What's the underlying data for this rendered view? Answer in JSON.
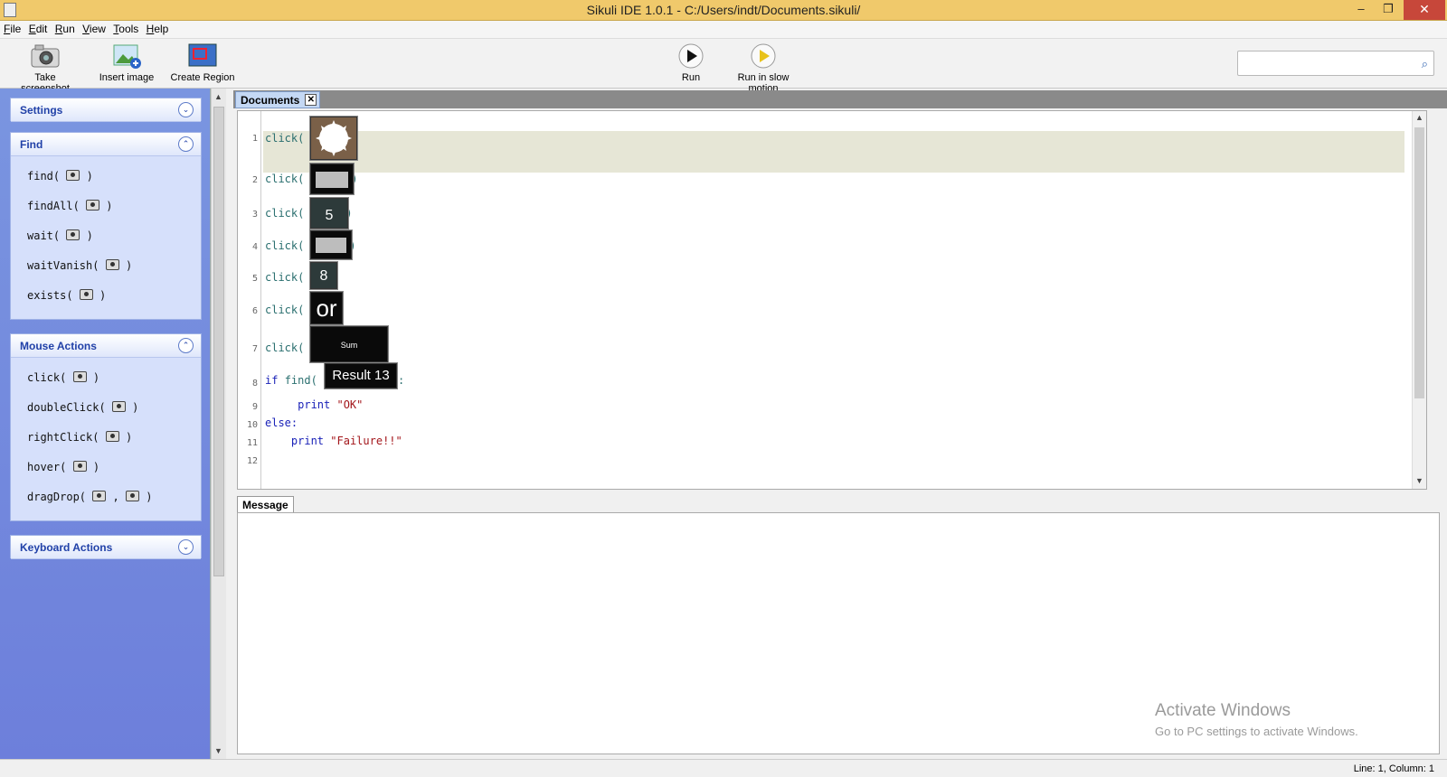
{
  "window": {
    "title": "Sikuli IDE 1.0.1 - C:/Users/indt/Documents.sikuli/",
    "minimize": "–",
    "restore": "❐",
    "close": "✕"
  },
  "menu": [
    "File",
    "Edit",
    "Run",
    "View",
    "Tools",
    "Help"
  ],
  "toolbar": {
    "take_screenshot": "Take screenshot",
    "insert_image": "Insert image",
    "create_region": "Create Region",
    "run": "Run",
    "run_slow": "Run in slow motion",
    "search_placeholder": "",
    "search_icon": "⌕"
  },
  "sidebar": {
    "settings": {
      "title": "Settings",
      "chevron": "⌄"
    },
    "find": {
      "title": "Find",
      "chevron": "⌃",
      "commands": [
        "find(",
        "findAll(",
        "wait(",
        "waitVanish(",
        "exists("
      ]
    },
    "mouse": {
      "title": "Mouse Actions",
      "chevron": "⌃",
      "commands": [
        "click(",
        "doubleClick(",
        "rightClick(",
        "hover(",
        "dragDrop("
      ]
    },
    "keyboard": {
      "title": "Keyboard Actions",
      "chevron": "⌄"
    },
    "close_paren": ")",
    "comma": ","
  },
  "editor": {
    "tab": "Documents",
    "tab_close": "✕",
    "line_numbers": [
      "1",
      "2",
      "3",
      "4",
      "5",
      "6",
      "7",
      "8",
      "9",
      "10",
      "11",
      "12"
    ],
    "lines": {
      "l1": "click(",
      "l2": "click(",
      "l3": "click(",
      "l4": "click(",
      "l5": "click(",
      "l6": "click(",
      "l7": "click(",
      "l8_kw": "if",
      "l8_fn": "find(",
      "l8_end": "):",
      "l9_kw": "print",
      "l9_str": "\"OK\"",
      "l10_kw": "else:",
      "l11_kw": "print",
      "l11_str": "\"Failure!!\"",
      "close": ")"
    },
    "shots": {
      "s3": "5",
      "s5": "8",
      "s6": "or",
      "s7": "Sum",
      "s8": "Result  13"
    }
  },
  "message": {
    "tab": "Message"
  },
  "watermark": {
    "line1": "Activate Windows",
    "line2": "Go to PC settings to activate Windows."
  },
  "status": "Line: 1, Column: 1",
  "colors": {
    "title_bar": "#f0c96b",
    "sidebar": "#7a95e0",
    "panel_header_text": "#2141a8",
    "keyword": "#1a22b8",
    "string": "#a3151a"
  }
}
